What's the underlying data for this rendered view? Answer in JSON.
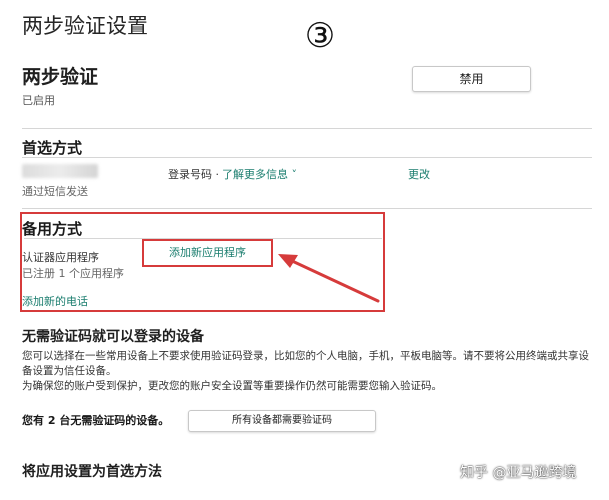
{
  "page_title": "两步验证设置",
  "step_badge": "③",
  "two_step": {
    "title": "两步验证",
    "status": "已启用",
    "disable_button": "禁用"
  },
  "preferred": {
    "title": "首选方式",
    "login_number_label": "登录号码 ·",
    "more_info_link": "了解更多信息 ˅",
    "change_link": "更改",
    "send_via": "通过短信发送"
  },
  "backup": {
    "title": "备用方式",
    "authenticator_label": "认证器应用程序",
    "authenticator_count": "已注册 1 个应用程序",
    "add_app_link": "添加新应用程序",
    "add_phone_link": "添加新的电话",
    "highlight_color": "#d63b3b"
  },
  "trusted_devices": {
    "title": "无需验证码就可以登录的设备",
    "paragraph1": "您可以选择在一些常用设备上不要求使用验证码登录，比如您的个人电脑，手机，平板电脑等。请不要将公用终端或共享设备设置为信任设备。",
    "paragraph2": "为确保您的账户受到保护，更改您的账户安全设置等重要操作仍然可能需要您输入验证码。",
    "device_count": "您有 2 台无需验证码的设备。",
    "require_all_button": "所有设备都需要验证码"
  },
  "app_preferred": {
    "title": "将应用设置为首选方法"
  },
  "watermark": "知乎 @亚马逊跨境",
  "colors": {
    "link": "#1a7d6e",
    "annotation": "#d63b3b"
  }
}
